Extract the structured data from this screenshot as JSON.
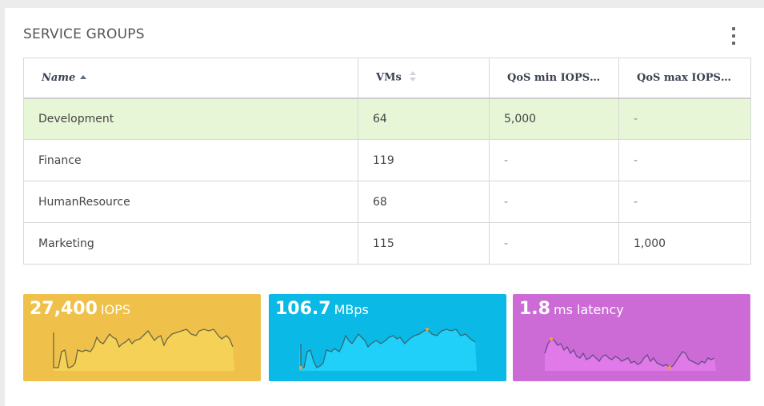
{
  "panel": {
    "title": "SERVICE GROUPS",
    "menu_icon": "more-vertical-icon"
  },
  "table": {
    "columns": [
      {
        "label": "Name",
        "sort": "ascending"
      },
      {
        "label": "VMs",
        "sort": "none"
      },
      {
        "label": "QoS min IOPS p..."
      },
      {
        "label": "QoS max IOPS p..."
      }
    ],
    "rows": [
      {
        "name": "Development",
        "vms": "64",
        "qos_min": "5,000",
        "qos_max": "-",
        "selected": true
      },
      {
        "name": "Finance",
        "vms": "119",
        "qos_min": "-",
        "qos_max": "-"
      },
      {
        "name": "HumanResource",
        "vms": "68",
        "qos_min": "-",
        "qos_max": "-"
      },
      {
        "name": "Marketing",
        "vms": "115",
        "qos_min": "-",
        "qos_max": "1,000"
      }
    ],
    "selected_row_color": "#e8f6d8"
  },
  "tiles": [
    {
      "value": "27,400",
      "unit": "IOPS",
      "bg": "#f0c14a",
      "fill": "#f5d257",
      "stroke": "#6b6840"
    },
    {
      "value": "106.7",
      "unit": "MBps",
      "bg": "#0bb9e6",
      "fill": "#20d0f8",
      "stroke": "#2f6a7a"
    },
    {
      "value": "1.8",
      "unit": "ms latency",
      "bg": "#cc6bd6",
      "fill": "#e07ae9",
      "stroke": "#6a4a8a"
    }
  ]
}
